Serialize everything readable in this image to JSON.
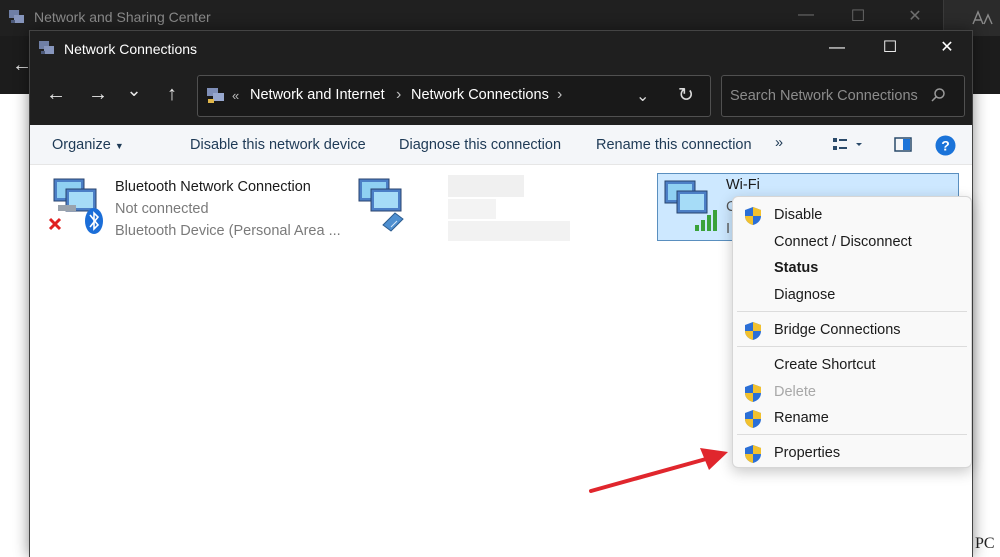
{
  "background_window": {
    "title": "Network and Sharing Center",
    "corner_text": "PC"
  },
  "window": {
    "title": "Network Connections",
    "minimize_glyph": "—",
    "maximize_glyph": "☐",
    "close_glyph": "✕"
  },
  "navigation": {
    "back_glyph": "←",
    "forward_glyph": "→",
    "recent_glyph": "⌄",
    "up_glyph": "↑"
  },
  "address": {
    "overflow": "«",
    "crumbs": [
      "Network and Internet",
      "Network Connections"
    ],
    "separator": "›",
    "dropdown_glyph": "⌄",
    "refresh_glyph": "↻"
  },
  "search": {
    "placeholder": "Search Network Connections"
  },
  "toolbar": {
    "organize": "Organize",
    "disable": "Disable this network device",
    "diagnose": "Diagnose this connection",
    "rename": "Rename this connection",
    "more": "»",
    "help": "?"
  },
  "connections": [
    {
      "name": "Bluetooth Network Connection",
      "status": "Not connected",
      "device": "Bluetooth Device (Personal Area ..."
    },
    {
      "name": "",
      "status": "",
      "device": ""
    },
    {
      "name": "Wi-Fi",
      "status": "C",
      "device": "I"
    }
  ],
  "context_menu": {
    "items": [
      {
        "label": "Disable",
        "shield": true
      },
      {
        "label": "Connect / Disconnect",
        "shield": false
      },
      {
        "label": "Status",
        "shield": false,
        "bold": true
      },
      {
        "label": "Diagnose",
        "shield": false
      },
      {
        "label": "Bridge Connections",
        "shield": true
      },
      {
        "label": "Create Shortcut",
        "shield": false
      },
      {
        "label": "Delete",
        "shield": true,
        "disabled": true
      },
      {
        "label": "Rename",
        "shield": true
      },
      {
        "label": "Properties",
        "shield": true
      }
    ]
  },
  "colors": {
    "titlebar": "#1f1f1f",
    "selection": "#cde8ff",
    "annotation_arrow": "#e0262d",
    "help_blue": "#1a73d9"
  }
}
